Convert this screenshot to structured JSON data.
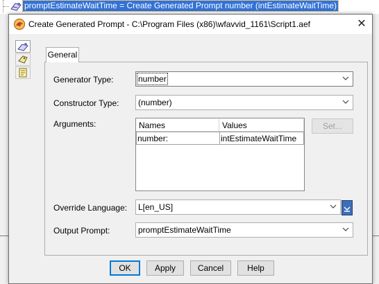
{
  "tree": {
    "node_label": "promptEstimateWaitTime = Create Generated Prompt number (intEstimateWaitTime)",
    "node_icon": "prompt-node-icon"
  },
  "dialog": {
    "title": "Create Generated Prompt - C:\\Program Files (x86)\\wfavvid_1161\\Script1.aef",
    "title_icon": "app-icon",
    "close_label": "✕",
    "side_tabs": [
      "general-step-icon",
      "prompt-tag-icon",
      "document-icon"
    ],
    "tab_general": "General",
    "fields": {
      "generator_type_label": "Generator Type:",
      "generator_type_value": "number",
      "constructor_type_label": "Constructor Type:",
      "constructor_type_value": "(number)",
      "arguments_label": "Arguments:",
      "override_language_label": "Override Language:",
      "override_language_value": "L[en_US]",
      "output_prompt_label": "Output Prompt:",
      "output_prompt_value": "promptEstimateWaitTime"
    },
    "arguments_table": {
      "columns": [
        "Names",
        "Values"
      ],
      "rows": [
        {
          "name": "number:",
          "value": "intEstimateWaitTime"
        }
      ]
    },
    "set_button": "Set...",
    "buttons": {
      "ok": "OK",
      "apply": "Apply",
      "cancel": "Cancel",
      "help": "Help"
    }
  },
  "colors": {
    "selection": "#3272d8",
    "dialog_bg": "#f0f0f0",
    "default_button_border": "#0078d7",
    "language_button": "#3c6fb8"
  }
}
